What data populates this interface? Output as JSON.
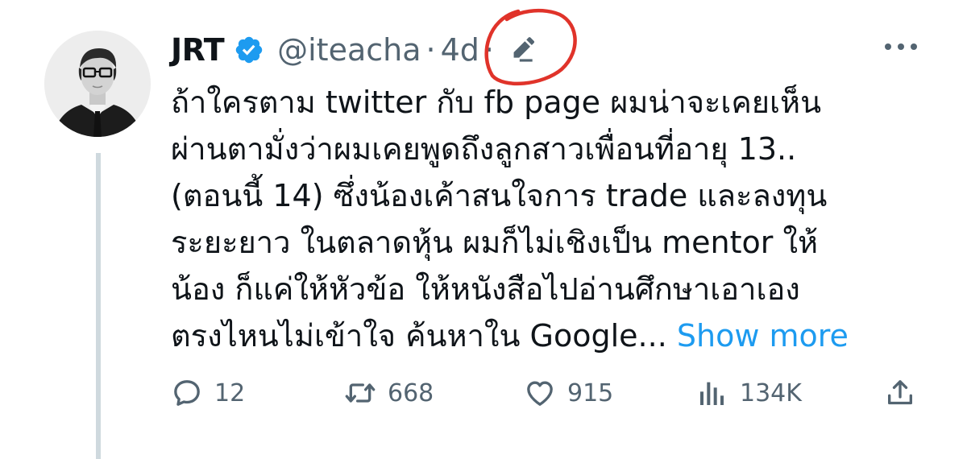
{
  "tweet": {
    "author_name": "JRT",
    "handle": "@iteacha",
    "separator": "·",
    "time_ago": "4d",
    "text_lines": [
      "ถ้าใครตาม twitter กับ fb page ผมน่าจะเคยเห็น",
      "ผ่านตามั่งว่าผมเคยพูดถึงลูกสาวเพื่อนที่อายุ 13..",
      "(ตอนนี้ 14) ซึ่งน้องเค้าสนใจการ trade และลงทุน",
      "ระยะยาว ในตลาดหุ้น ผมก็ไม่เชิงเป็น mentor ให้",
      "น้อง ก็แค่ให้หัวข้อ  ให้หนังสือไปอ่านศึกษาเอาเอง",
      "ตรงไหนไม่เข้าใจ ค้นหาใน Google..."
    ],
    "show_more_label": "Show more"
  },
  "actions": {
    "reply_count": "12",
    "retweet_count": "668",
    "like_count": "915",
    "views_count": "134K"
  },
  "icons": {
    "verified": "verified-badge-icon",
    "edit": "edited-pencil-icon",
    "more": "more-dots-icon",
    "reply": "reply-bubble-icon",
    "retweet": "retweet-icon",
    "like": "heart-icon",
    "views": "views-chart-icon",
    "share": "share-upload-icon"
  },
  "colors": {
    "text": "#0f1419",
    "secondary": "#536471",
    "link": "#1d9bf0",
    "verified": "#1d9bf0",
    "annotation": "#e0332a",
    "thread_line": "#cfd9de"
  }
}
